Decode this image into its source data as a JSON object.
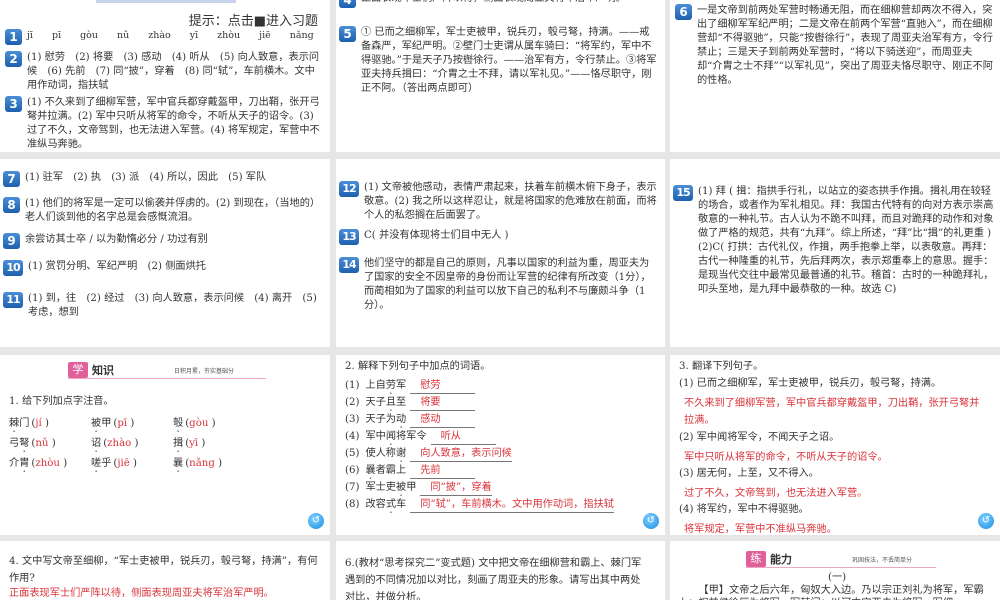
{
  "hint": "提示：点击■进入习题",
  "p1": [
    {
      "n": "1",
      "t": "jī　　pī　　gòu　　nǔ　　zhào　　yī　　zhòu　　jiē　　nǎng"
    },
    {
      "n": "2",
      "t": "(1) 慰劳　(2) 将要　(3) 感动　(4) 听从　(5) 向人致意，表示问候　(6) 先前　(7) 同“披”，穿着　(8) 同“轼”，车前横木。文中用作动词，指扶轼"
    },
    {
      "n": "3",
      "t": "(1) 不久来到了细柳军营，军中官兵都穿戴盔甲，刀出鞘，张开弓弩并拉满。(2) 军中只听从将军的命令，不听从天子的诏令。(3) 过了不久，文帝驾到，也无法进入军营。(4) 将军规定，军营中不准纵马奔驰。"
    }
  ],
  "p2": [
    {
      "n": "4",
      "t": "正面表现军士们严阵以待，侧面表现周亚夫将军治军严明。"
    },
    {
      "n": "5",
      "t": "① 已而之细柳军，军士吏被甲，锐兵刃，彀弓弩，持满。——戒备森严，军纪严明。②壁门士吏谓从属车骑曰：“将军约，军中不得驱驰。”于是天子乃按辔徐行。——治军有方，令行禁止。③将军亚夫持兵揖曰：“介胄之士不拜，请以军礼见。”——恪尽职守，刚正不阿。（答出两点即可）"
    }
  ],
  "p3": [
    {
      "n": "6",
      "t": "一是文帝到前两处军营时畅通无阻，而在细柳营却两次不得入，突出了细柳军军纪严明；二是文帝在前两个军营“直驰入”，而在细柳营却“不得驱驰”，只能“按辔徐行”，表现了周亚夫治军有方，令行禁止；三是天子到前两处军营时，“将以下骑送迎”，而周亚夫却“介胄之士不拜”“以军礼见”，突出了周亚夫恪尽职守、刚正不阿的性格。"
    }
  ],
  "p4": [
    {
      "n": "7",
      "t": "(1) 驻军　(2) 执　(3) 派　(4) 所以，因此　(5) 军队"
    },
    {
      "n": "8",
      "t": "(1) 他们的将军是一定可以偷袭并俘虏的。(2) 到现在，（当地的）老人们谈到他的名字总是会感慨流泪。"
    },
    {
      "n": "9",
      "t": "余尝访其士卒 / 以为勤惰必分 / 功过有别"
    },
    {
      "n": "10",
      "t": "(1) 赏罚分明、军纪严明　(2) 侧面烘托"
    },
    {
      "n": "11",
      "t": "(1) 到，往　(2) 经过　(3) 向人致意，表示问候　(4) 离开　(5) 考虑，想到"
    }
  ],
  "p5": [
    {
      "n": "12",
      "t": "(1) 文帝被他感动，表情严肃起来，扶着车前横木俯下身子，表示敬意。(2) 我之所以这样忍让，就是将国家的危难放在前面，而将个人的私怨搁在后面罢了。"
    },
    {
      "n": "13",
      "t": "C( 并没有体现将士们目中无人 )"
    },
    {
      "n": "14",
      "t": "他们坚守的都是自己的原则，凡事以国家的利益为重，周亚夫为了国家的安全不因皇帝的身份而让军营的纪律有所改变（1分），而蔺相如为了国家的利益可以放下自己的私利不与廉颇斗争（1分）。"
    }
  ],
  "p6": [
    {
      "n": "15",
      "t": "(1) 拜 ( 揖：指拱手行礼，以站立的姿态拱手作揖。揖礼用在较轻的场合，或者作为军礼相见。拜：我国古代特有的向对方表示崇高敬意的一种礼节。古人认为不跪不叫拜，而且对跪拜的动作和对象做了严格的规范，共有“九拜”。综上所述，“拜”比“揖”的礼更重 )(2)C( 打拱：古代礼仪，作揖，两手抱拳上举，以表敬意。再拜：古代一种隆重的礼节，先后拜两次，表示郑重奉上的意思。握手：是现当代交往中最常见最普通的礼节。稽首：古时的一种跪拜礼，叩头至地，是九拜中最恭敬的一种。故选 C)"
    }
  ],
  "p7": {
    "header_icon": "学",
    "header_title": "知识",
    "header_sub": "日积月累，夯实基础分",
    "question": "1. 给下列加点字注音。",
    "items": [
      {
        "pre": "",
        "dot": "棘",
        "post": "门",
        "ans": "jí"
      },
      {
        "pre": "",
        "dot": "被",
        "post": "甲",
        "ans": "pī"
      },
      {
        "pre": "",
        "dot": "彀",
        "post": "",
        "ans": "gòu"
      },
      {
        "pre": "弓",
        "dot": "弩",
        "post": "",
        "ans": "nǔ"
      },
      {
        "pre": "",
        "dot": "诏",
        "post": "",
        "ans": "zhào"
      },
      {
        "pre": "",
        "dot": "揖",
        "post": "",
        "ans": "yī"
      },
      {
        "pre": "介",
        "dot": "胄",
        "post": "",
        "ans": "zhòu"
      },
      {
        "pre": "",
        "dot": "嗟",
        "post": "乎",
        "ans": "jiē"
      },
      {
        "pre": "",
        "dot": "曩",
        "post": "",
        "ans": "nǎng"
      }
    ]
  },
  "p8": {
    "question": "2. 解释下列句子中加点的词语。",
    "items": [
      {
        "num": "(1)",
        "pre": "上自",
        "dot": "劳",
        "post": "军",
        "ans": "慰劳"
      },
      {
        "num": "(2)",
        "pre": "天子",
        "dot": "且",
        "post": "至",
        "ans": "将要"
      },
      {
        "num": "(3)",
        "pre": "天子为",
        "dot": "动",
        "post": "",
        "ans": "感动"
      },
      {
        "num": "(4)",
        "pre": "军中",
        "dot": "闻",
        "post": "将军令",
        "ans": "听从"
      },
      {
        "num": "(5)",
        "pre": "使人称",
        "dot": "谢",
        "post": "",
        "ans": "向人致意，表示问候"
      },
      {
        "num": "(6)",
        "pre": "",
        "dot": "曩",
        "post": "者霸上",
        "ans": "先前"
      },
      {
        "num": "(7)",
        "pre": "军士吏",
        "dot": "被",
        "post": "甲",
        "ans": "同“披”，穿着"
      },
      {
        "num": "(8)",
        "pre": "改容",
        "dot": "式",
        "post": "车",
        "ans": "同“轼”，车前横木。文中用作动词，指扶轼"
      }
    ]
  },
  "p9": {
    "question": "3. 翻译下列句子。",
    "items": [
      {
        "q": "(1) 已而之细柳军，军士吏被甲，锐兵刃，彀弓弩，持满。",
        "a": "不久来到了细柳军营，军中官兵都穿戴盔甲，刀出鞘，张开弓弩并拉满。"
      },
      {
        "q": "(2) 军中闻将军令，不闻天子之诏。",
        "a": "军中只听从将军的命令，不听从天子的诏令。"
      },
      {
        "q": "(3) 居无何，上至，又不得入。",
        "a": "过了不久，文帝驾到，也无法进入军营。"
      },
      {
        "q": "(4) 将军约，军中不得驱驰。",
        "a": "将军规定，军营中不准纵马奔驰。"
      }
    ]
  },
  "p10": {
    "q": "4. 文中写文帝至细柳，“军士吏被甲，锐兵刃，彀弓弩，持满”，有何作用?",
    "a": "正面表现军士们严阵以待，侧面表现周亚夫将军治军严明。"
  },
  "p11": {
    "q": "6.(教材“思考探究二”变式题) 文中把文帝在细柳营和霸上、棘门军遇到的不同情况加以对比，刻画了周亚夫的形象。请写出其中两处对比，并做分析。"
  },
  "p12": {
    "header_icon": "练",
    "header_title": "能力",
    "header_sub": "巩固技法，不丢简单分",
    "section": "(一)",
    "text": "【甲】文帝之后六年，匈奴大入边。乃以宗正刘礼为将军，军霸上；祝兹侯徐厉为将军，军棘门；以河内守亚夫为将军，军细"
  },
  "return_icon": "↺"
}
